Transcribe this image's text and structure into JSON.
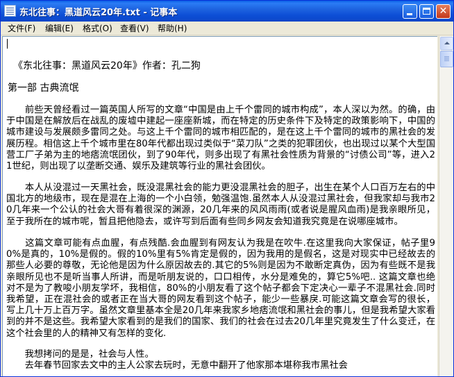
{
  "window": {
    "title": "东北往事：黑道风云20年.txt - 记事本"
  },
  "menu": {
    "items": [
      "文件(F)",
      "编辑(E)",
      "格式(O)",
      "查看(V)",
      "帮助(H)"
    ]
  },
  "document": {
    "title_line": "《东北往事：黑道风云20年》作者：孔二狗",
    "section_line": "第一部      古典流氓",
    "paragraphs": [
      "　　前些天曾经看过一篇英国人所写的文章“中国是由上千个雷同的城市构成”，本人深以为然。的确，由于中国是在解放后在战乱的废墟中建起一座座新城，而在特定的历史条件下及特定的政策影响下，中国的城市建设与发展颇多雷同之处。与这上千个雷同的城市相匹配的，是在这上千个雷同的城市的黑社会的发展历程。相信这上千个城市里在80年代都出现过类似于“菜刀队”之类的犯罪团伙，也出现过以某个大型国营工厂子弟为主的地痞流氓团伙，到了90年代，则多出现了有黑社会性质为背景的“讨债公司”等，进入21世纪，则出现了以垄断交通、娱乐及建筑等行业的黑社会团伙。",
      "　　本人从没混过一天黑社会，既没混黑社会的能力更没混黑社会的胆子，出生在某个人口百万左右的中国北方的地级市，现在是混在上海的一个小白领，勉强温饱.虽然本人从没混过黑社会，但我家却与我市20几年来一个公认的社会大哥有着很深的渊源，20几年来的风风雨雨(或者说是腥风血雨)是我亲眼所见，至于我所在的城市呢，暂且把他隐去，或许写到后面有些同乡网友会知道我究竟是在说哪座城市。",
      "　　这篇文章可能有点血腥，有点残酷.会血腥到有网友认为我是在吹牛.在这里我向大家保证，帖子里90%是真的，10%是假的。假的10%里有5%肯定是假的，因为我用的是假名，这是对现实中已经故去的那些人必要的尊敬，无论他是因为什么原因故去的.其它的5%则是因为不敢断定真伪，因为有些既不是我亲眼所见也不是听当事人所讲，而是听朋友说的，口口相传，水分是难免的，算它5%吧.. 这篇文章也绝对不是为了教唆小朋友学坏，我相信，80%的小朋友看了这个帖子都会下定决心一辈子不混黑社会.同时我希望，正在混社会的或者正在当大哥的网友看到这个帖子，能少一些暴戾.可能这篇文章会写的很长， 写上几十万上百万字。虽然文章里基本全是20几年来我家乡地痞流氓和黑社会的事儿，但是我希望大家看到的并不是这些。我希望大家看到的是我们的国家、我们的社会在过去20几年里究竟发生了什么变迁，在这个社会里的人的精神又有怎样的变化.",
      "　　我想拷问的是是，社会与人性。",
      "　　去年春节回家去文中的主人公家去玩时，无意中翻开了他家那本堪称我市黑社会"
    ]
  }
}
